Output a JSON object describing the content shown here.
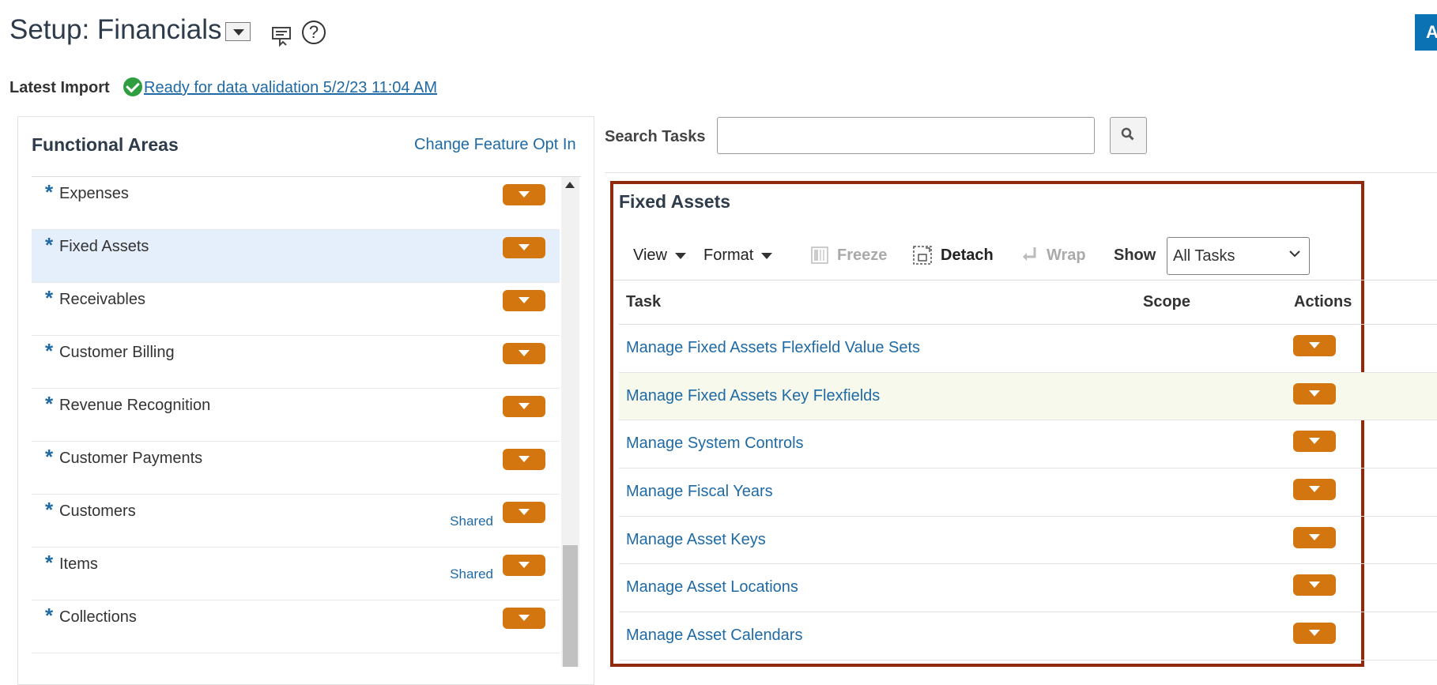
{
  "header": {
    "title": "Setup: Financials",
    "top_right_button": "A"
  },
  "latest_import": {
    "label": "Latest Import",
    "status_link": "Ready for data validation 5/2/23 11:04 AM"
  },
  "functional_areas": {
    "title": "Functional Areas",
    "change_opt_in": "Change Feature Opt In",
    "items": [
      {
        "label": "Expenses",
        "shared": ""
      },
      {
        "label": "Fixed Assets",
        "shared": "",
        "selected": true
      },
      {
        "label": "Receivables",
        "shared": ""
      },
      {
        "label": "Customer Billing",
        "shared": ""
      },
      {
        "label": "Revenue Recognition",
        "shared": ""
      },
      {
        "label": "Customer Payments",
        "shared": ""
      },
      {
        "label": "Customers",
        "shared": "Shared"
      },
      {
        "label": "Items",
        "shared": "Shared"
      },
      {
        "label": "Collections",
        "shared": ""
      }
    ]
  },
  "search": {
    "label": "Search Tasks",
    "placeholder": ""
  },
  "tasks_panel": {
    "title": "Fixed Assets",
    "toolbar": {
      "view": "View",
      "format": "Format",
      "freeze": "Freeze",
      "detach": "Detach",
      "wrap": "Wrap",
      "show_label": "Show",
      "show_value": "All Tasks"
    },
    "columns": {
      "task": "Task",
      "scope": "Scope",
      "actions": "Actions"
    },
    "rows": [
      {
        "task": "Manage Fixed Assets Flexfield Value Sets"
      },
      {
        "task": "Manage Fixed Assets Key Flexfields",
        "highlighted": true
      },
      {
        "task": "Manage System Controls"
      },
      {
        "task": "Manage Fiscal Years"
      },
      {
        "task": "Manage Asset Keys"
      },
      {
        "task": "Manage Asset Locations"
      },
      {
        "task": "Manage Asset Calendars"
      }
    ]
  },
  "colors": {
    "accent_orange": "#d4760f",
    "link_blue": "#1f6aa5",
    "highlight_box": "#8f2a0e",
    "selected_row": "#e4effb"
  }
}
